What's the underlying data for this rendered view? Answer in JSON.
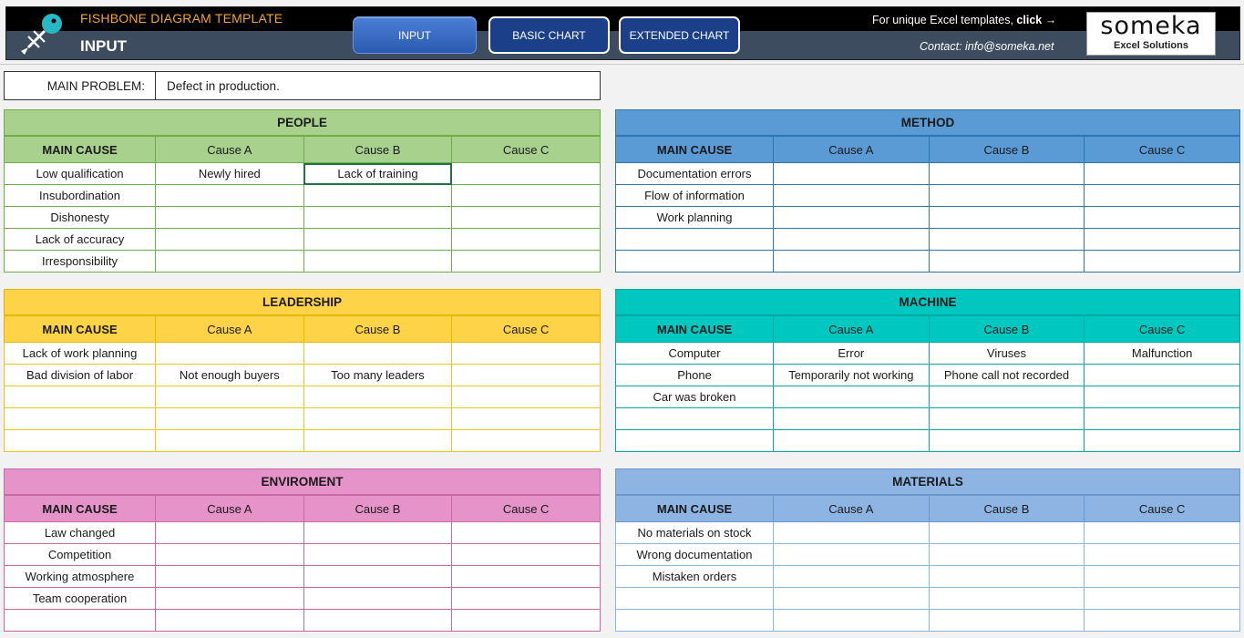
{
  "header": {
    "title": "FISHBONE DIAGRAM TEMPLATE",
    "subtitle": "INPUT",
    "nav": {
      "input": "INPUT",
      "basic": "BASIC CHART",
      "extended": "EXTENDED CHART"
    },
    "promo_text": "For unique Excel templates, ",
    "promo_link": "click →",
    "contact": "Contact: info@someka.net",
    "brand_name": "someka",
    "brand_sub": "Excel Solutions",
    "colors": {
      "bar": "#3d4c5e",
      "title": "#f5a623",
      "active_button": "#3a6dc4"
    }
  },
  "problem": {
    "label": "MAIN PROBLEM:",
    "value": "Defect in production."
  },
  "columns": [
    "MAIN CAUSE",
    "Cause A",
    "Cause B",
    "Cause C"
  ],
  "categories": {
    "people": {
      "title": "PEOPLE",
      "rows": [
        [
          "Low qualification",
          "Newly hired",
          "Lack of training",
          ""
        ],
        [
          "Insubordination",
          "",
          "",
          ""
        ],
        [
          "Dishonesty",
          "",
          "",
          ""
        ],
        [
          "Lack of accuracy",
          "",
          "",
          ""
        ],
        [
          "Irresponsibility",
          "",
          "",
          ""
        ]
      ]
    },
    "method": {
      "title": "METHOD",
      "rows": [
        [
          "Documentation errors",
          "",
          "",
          ""
        ],
        [
          "Flow of information",
          "",
          "",
          ""
        ],
        [
          "Work planning",
          "",
          "",
          ""
        ],
        [
          "",
          "",
          "",
          ""
        ],
        [
          "",
          "",
          "",
          ""
        ]
      ]
    },
    "leadership": {
      "title": "LEADERSHIP",
      "rows": [
        [
          "Lack of work planning",
          "",
          "",
          ""
        ],
        [
          "Bad division of labor",
          "Not enough buyers",
          "Too many leaders",
          ""
        ],
        [
          "",
          "",
          "",
          ""
        ],
        [
          "",
          "",
          "",
          ""
        ],
        [
          "",
          "",
          "",
          ""
        ]
      ]
    },
    "machine": {
      "title": "MACHINE",
      "rows": [
        [
          "Computer",
          "Error",
          "Viruses",
          "Malfunction"
        ],
        [
          "Phone",
          "Temporarily not working",
          "Phone call not recorded",
          ""
        ],
        [
          "Car was broken",
          "",
          "",
          ""
        ],
        [
          "",
          "",
          "",
          ""
        ],
        [
          "",
          "",
          "",
          ""
        ]
      ]
    },
    "enviroment": {
      "title": "ENVIROMENT",
      "rows": [
        [
          "Law changed",
          "",
          "",
          ""
        ],
        [
          "Competition",
          "",
          "",
          ""
        ],
        [
          "Working atmosphere",
          "",
          "",
          ""
        ],
        [
          "Team cooperation",
          "",
          "",
          ""
        ],
        [
          "",
          "",
          "",
          ""
        ]
      ]
    },
    "materials": {
      "title": "MATERIALS",
      "rows": [
        [
          "No materials on stock",
          "",
          "",
          ""
        ],
        [
          "Wrong  documentation",
          "",
          "",
          ""
        ],
        [
          "Mistaken orders",
          "",
          "",
          ""
        ],
        [
          "",
          "",
          "",
          ""
        ],
        [
          "",
          "",
          "",
          ""
        ]
      ]
    }
  }
}
